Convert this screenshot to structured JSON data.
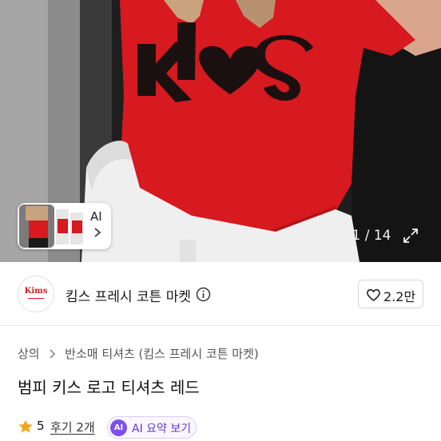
{
  "gallery": {
    "thumbnail_label": "AI",
    "page_counter": "1 / 14"
  },
  "shop": {
    "logo_text": "Kims",
    "name": "킴스 프레시 코튼 마켓",
    "like_count": "2.2만"
  },
  "breadcrumb": [
    "상의",
    "반소매 티셔츠",
    "(킴스 프레시 코튼 마켓)"
  ],
  "product": {
    "title": "범피 키스 로고 티셔츠 레드"
  },
  "rating": {
    "value": "5",
    "review_label": "후기 2개",
    "ai_badge": "AI",
    "ai_summary_label": "AI 요약 보기"
  },
  "colors": {
    "accent_purple": "#7d4ff2",
    "star": "#f5a623",
    "brand_red": "#d8181f"
  },
  "icons": [
    "chevron-right-icon",
    "expand-icon",
    "info-icon",
    "heart-icon",
    "star-icon"
  ]
}
